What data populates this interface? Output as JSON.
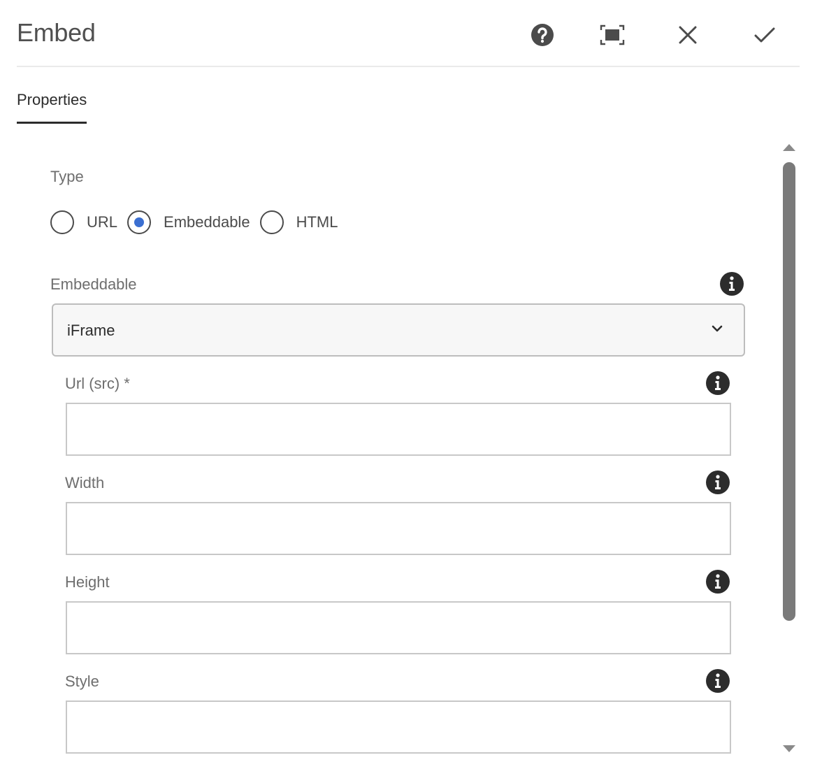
{
  "header": {
    "title": "Embed",
    "buttons": {
      "help_icon": "help-circle-icon",
      "fullscreen_icon": "fullscreen-icon",
      "close_icon": "close-icon",
      "done_icon": "checkmark-icon"
    }
  },
  "tabs": [
    {
      "label": "Properties",
      "active": true
    }
  ],
  "form": {
    "type": {
      "label": "Type",
      "options": [
        {
          "label": "URL",
          "checked": false
        },
        {
          "label": "Embeddable",
          "checked": true
        },
        {
          "label": "HTML",
          "checked": false
        }
      ]
    },
    "embeddable": {
      "label": "Embeddable",
      "selected": "iFrame"
    },
    "fields": {
      "url": {
        "label": "Url (src) *",
        "value": ""
      },
      "width": {
        "label": "Width",
        "value": ""
      },
      "height": {
        "label": "Height",
        "value": ""
      },
      "style": {
        "label": "Style",
        "value": ""
      }
    }
  },
  "colors": {
    "accent": "#3b6fd1",
    "text": "#4b4b4b",
    "border": "#c8c8c8"
  }
}
